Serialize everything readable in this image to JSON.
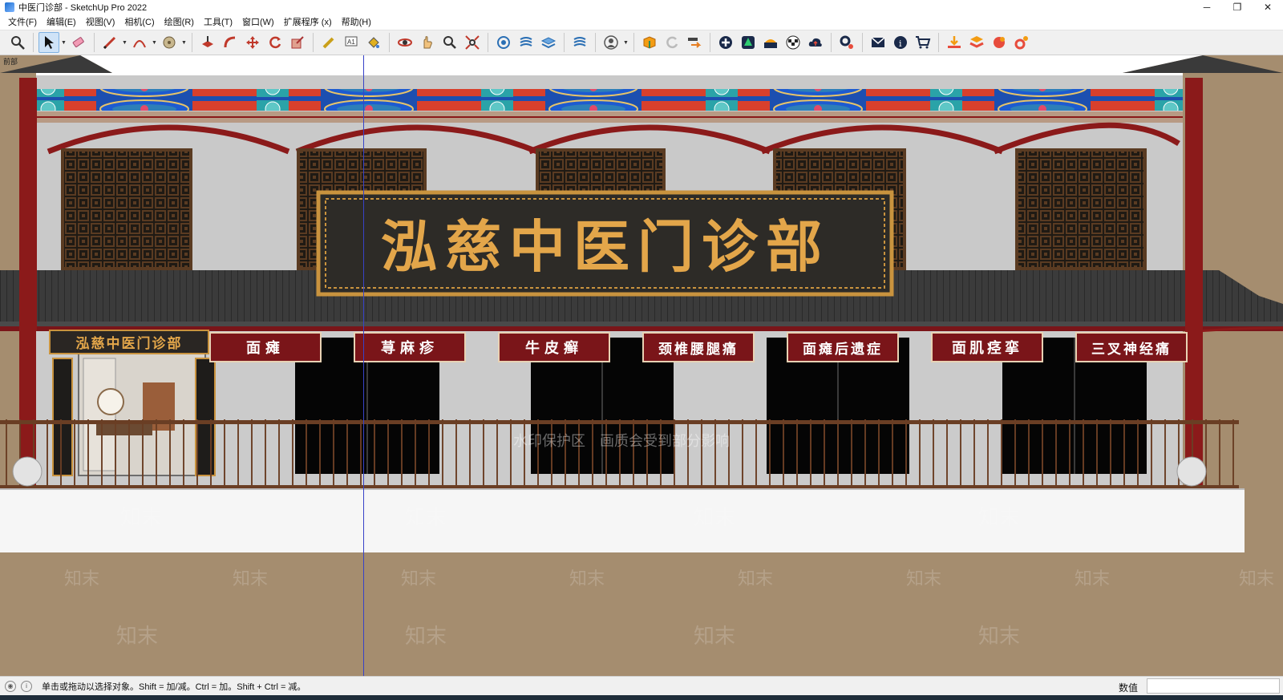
{
  "window": {
    "title": "中医门诊部 - SketchUp Pro 2022",
    "minimize": "─",
    "maximize": "❐",
    "close": "✕"
  },
  "menu": [
    "文件(F)",
    "编辑(E)",
    "视图(V)",
    "相机(C)",
    "绘图(R)",
    "工具(T)",
    "窗口(W)",
    "扩展程序 (x)",
    "帮助(H)"
  ],
  "toolbar": {
    "icons": [
      "zoom-icon",
      "select-icon",
      "eraser-icon",
      "pencil-icon",
      "arc-icon",
      "offset-icon",
      "push-pull-icon",
      "follow-me-icon",
      "move-icon",
      "rotate-icon",
      "scale-icon",
      "tape-measure-icon",
      "text-icon",
      "paint-bucket-icon",
      "orbit-icon",
      "pan-icon",
      "zoom-window-icon",
      "zoom-extents-icon",
      "component-icon",
      "section-plane-icon",
      "layers-icon",
      "styles-icon",
      "user-icon",
      "extension-warehouse-icon",
      "reload-icon",
      "export-icon",
      "add-icon",
      "tree-icon",
      "layout-icon",
      "checker-icon",
      "cloud-upload-icon",
      "gears-icon",
      "mail-icon",
      "info-icon",
      "cart-icon",
      "plugin-a-icon",
      "plugin-b-icon",
      "plugin-c-icon",
      "plugin-d-icon"
    ],
    "active": "select-icon"
  },
  "scene": {
    "label": "前部",
    "main_sign": "泓慈中医门诊部",
    "small_sign": "泓慈中医门诊部",
    "plaques": [
      "面瘫",
      "荨麻疹",
      "牛皮癣",
      "颈椎腰腿痛",
      "面瘫后遗症",
      "面肌痉挛",
      "三叉神经痛"
    ],
    "watermark_center": "水印保护区　画质会受到部分影响",
    "watermark": "知末",
    "colors": {
      "roof": "#3a3a3a",
      "pillar": "#8b1a1a",
      "sign_bg": "#2d2b27",
      "sign_text": "#e3a64a",
      "wall": "#c8c8c8",
      "plaque": "#7a1519",
      "ground": "#a58d6f"
    }
  },
  "status": {
    "hint": "单击或拖动以选择对象。Shift = 加/减。Ctrl = 加。Shift + Ctrl = 减。",
    "measure_label": "数值",
    "measure_value": ""
  }
}
